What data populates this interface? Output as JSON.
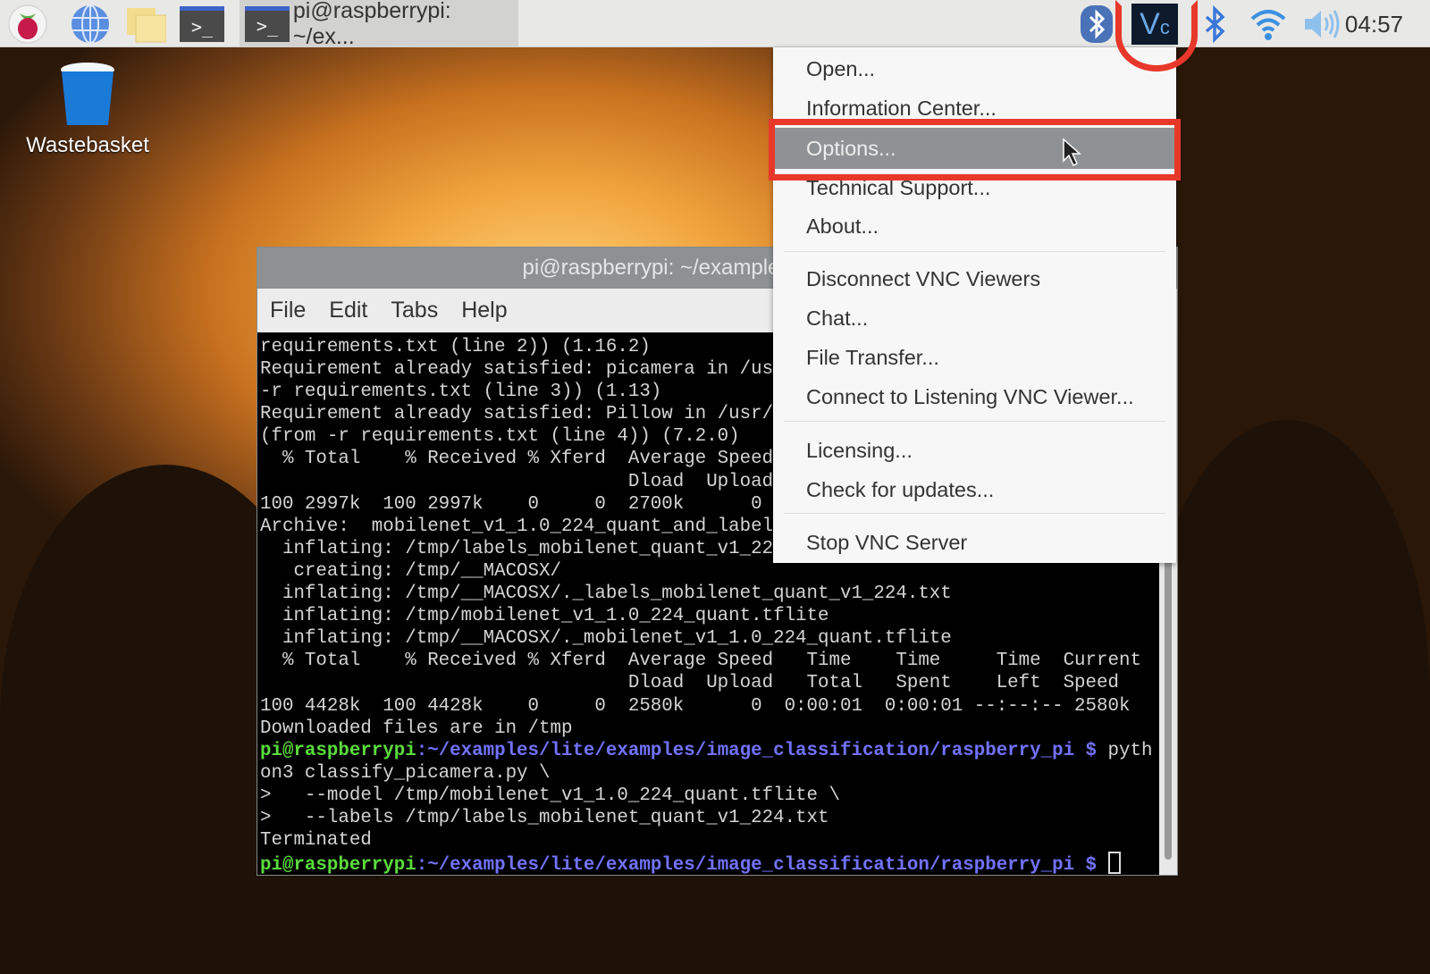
{
  "taskbar": {
    "task_label": "pi@raspberrypi: ~/ex...",
    "clock": "04:57"
  },
  "desktop": {
    "wastebasket": "Wastebasket"
  },
  "terminal": {
    "title": "pi@raspberrypi: ~/examples/lite/e.../imag",
    "menu": [
      "File",
      "Edit",
      "Tabs",
      "Help"
    ],
    "lines": [
      "requirements.txt (line 2)) (1.16.2)",
      "Requirement already satisfied: picamera in /us",
      "-r requirements.txt (line 3)) (1.13)",
      "Requirement already satisfied: Pillow in /usr/",
      "(from -r requirements.txt (line 4)) (7.2.0)",
      "  % Total    % Received % Xferd  Average Speed",
      "                                 Dload  Upload",
      "100 2997k  100 2997k    0     0  2700k      0",
      "Archive:  mobilenet_v1_1.0_224_quant_and_label",
      "  inflating: /tmp/labels_mobilenet_quant_v1_22",
      "   creating: /tmp/__MACOSX/",
      "  inflating: /tmp/__MACOSX/._labels_mobilenet_quant_v1_224.txt",
      "  inflating: /tmp/mobilenet_v1_1.0_224_quant.tflite",
      "  inflating: /tmp/__MACOSX/._mobilenet_v1_1.0_224_quant.tflite",
      "  % Total    % Received % Xferd  Average Speed   Time    Time     Time  Current",
      "                                 Dload  Upload   Total   Spent    Left  Speed",
      "100 4428k  100 4428k    0     0  2580k      0  0:00:01  0:00:01 --:--:-- 2580k",
      "Downloaded files are in /tmp"
    ],
    "prompt_user": "pi@raspberrypi",
    "prompt_path": ":~/examples/lite/examples/image_classification/raspberry_pi $ ",
    "cmd1": "pyth",
    "lines2": [
      "on3 classify_picamera.py \\",
      ">   --model /tmp/mobilenet_v1_1.0_224_quant.tflite \\",
      ">   --labels /tmp/labels_mobilenet_quant_v1_224.txt",
      "Terminated"
    ]
  },
  "vnc_menu": {
    "items": [
      "Open...",
      "Information Center...",
      "Options...",
      "Technical Support...",
      "About...",
      "Disconnect VNC Viewers",
      "Chat...",
      "File Transfer...",
      "Connect to Listening VNC Viewer...",
      "Licensing...",
      "Check for updates...",
      "Stop VNC Server"
    ],
    "highlighted": "Options..."
  },
  "colors": {
    "annotation": "#e8382a",
    "prompt_user": "#5adc3c",
    "prompt_path": "#7272ff"
  }
}
